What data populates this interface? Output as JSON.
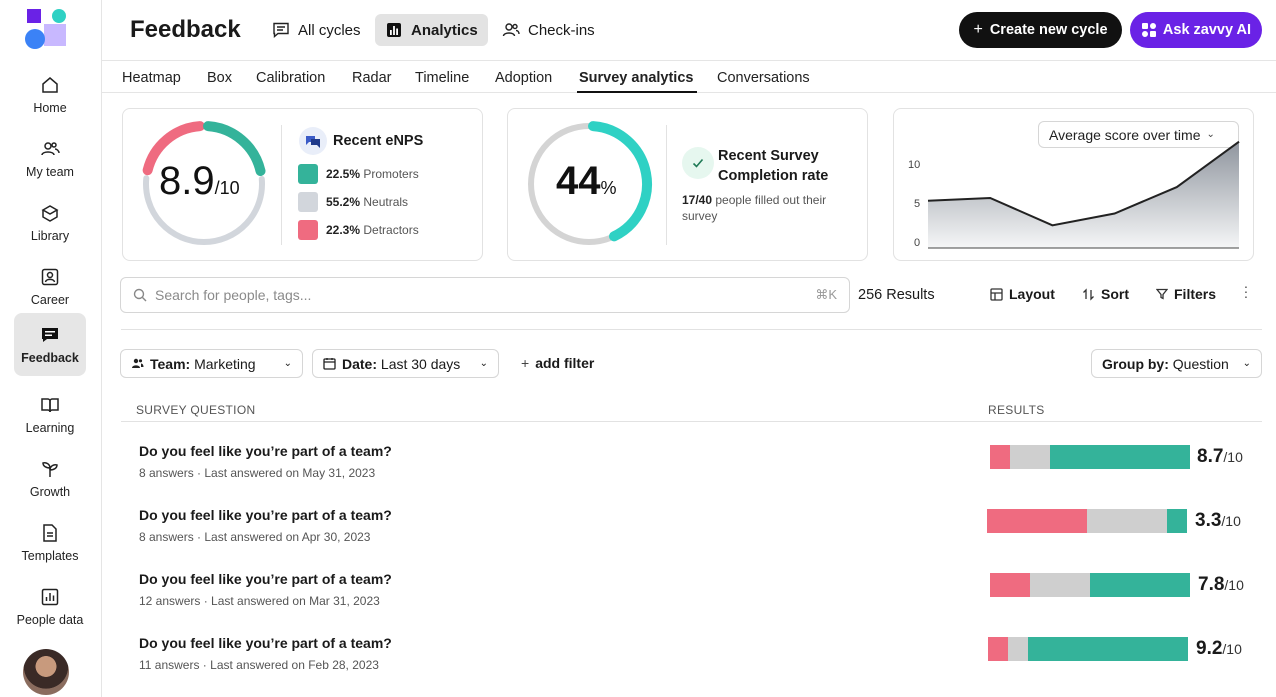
{
  "sidebar": {
    "items": [
      {
        "label": "Home",
        "icon": "home-icon"
      },
      {
        "label": "My team",
        "icon": "team-icon"
      },
      {
        "label": "Library",
        "icon": "library-icon"
      },
      {
        "label": "Career",
        "icon": "career-icon"
      },
      {
        "label": "Feedback",
        "icon": "feedback-icon",
        "active": true
      },
      {
        "label": "Learning",
        "icon": "learning-icon"
      },
      {
        "label": "Growth",
        "icon": "growth-icon"
      },
      {
        "label": "Templates",
        "icon": "templates-icon"
      },
      {
        "label": "People data",
        "icon": "people-data-icon"
      }
    ]
  },
  "header": {
    "title": "Feedback",
    "tabs": [
      {
        "label": "All cycles"
      },
      {
        "label": "Analytics",
        "active": true
      },
      {
        "label": "Check-ins"
      }
    ],
    "create_label": "Create new cycle",
    "ai_label": "Ask zavvy AI"
  },
  "subtabs": [
    "Heatmap",
    "Box",
    "Calibration",
    "Radar",
    "Timeline",
    "Adoption",
    "Survey analytics",
    "Conversations"
  ],
  "enps": {
    "score": "8.9",
    "out_of": "/10",
    "title": "Recent eNPS",
    "promoters": {
      "pct": "22.5%",
      "label": "Promoters"
    },
    "neutrals": {
      "pct": "55.2%",
      "label": "Neutrals"
    },
    "detractors": {
      "pct": "22.3%",
      "label": "Detractors"
    },
    "colors": {
      "promoters": "#34b39a",
      "neutrals": "#d2d6dc",
      "detractors": "#ef6b80"
    }
  },
  "completion": {
    "value": "44",
    "unit": "%",
    "percent": 44,
    "title": "Recent Survey Completion rate",
    "count": "17/40",
    "detail": "people filled out their survey",
    "accent": "#2fd1c4"
  },
  "trend": {
    "select": "Average score over time",
    "chart_data": {
      "type": "area",
      "values": [
        5.2,
        5.5,
        2.5,
        3.8,
        6.7,
        11.7
      ],
      "ylim": [
        0,
        12
      ],
      "yticks": [
        "10",
        "5",
        "0"
      ]
    }
  },
  "search": {
    "placeholder": "Search for people, tags...",
    "shortcut": "⌘K"
  },
  "results_label": "256 Results",
  "tools": {
    "layout": "Layout",
    "sort": "Sort",
    "filters": "Filters"
  },
  "filters": {
    "team_key": "Team:",
    "team_val": "Marketing",
    "date_key": "Date:",
    "date_val": "Last 30 days",
    "add": "add filter",
    "group_key": "Group by:",
    "group_val": "Question"
  },
  "table": {
    "col_question": "SURVEY QUESTION",
    "col_results": "RESULTS",
    "rows": [
      {
        "question": "Do you feel like you’re part of a team?",
        "meta": "8 answers · Last answered on May 31, 2023",
        "score": "8.7",
        "out_of": "/10",
        "detractors": 10,
        "neutrals": 20,
        "promoters": 70
      },
      {
        "question": "Do you feel like you’re part of a team?",
        "meta": "8 answers · Last answered on Apr 30, 2023",
        "score": "3.3",
        "out_of": "/10",
        "detractors": 50,
        "neutrals": 40,
        "promoters": 10
      },
      {
        "question": "Do you feel like you’re part of a team?",
        "meta": "12 answers · Last answered on Mar 31, 2023",
        "score": "7.8",
        "out_of": "/10",
        "detractors": 20,
        "neutrals": 30,
        "promoters": 50
      },
      {
        "question": "Do you feel like you’re part of a team?",
        "meta": "11 answers · Last answered on Feb 28, 2023",
        "score": "9.2",
        "out_of": "/10",
        "detractors": 10,
        "neutrals": 10,
        "promoters": 80
      }
    ]
  }
}
